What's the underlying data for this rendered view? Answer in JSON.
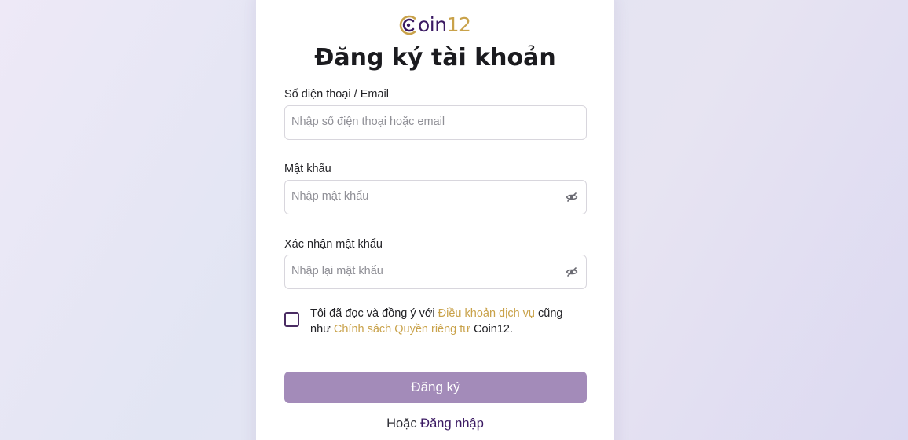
{
  "brand": {
    "logo_word": "oin",
    "logo_number": "12",
    "logo_letter": "C",
    "colors": {
      "primary": "#3b1a63",
      "gold": "#c9a24a",
      "button": "#a38bb9"
    }
  },
  "page": {
    "title": "Đăng ký tài khoản"
  },
  "form": {
    "contact": {
      "label": "Số điện thoại / Email",
      "placeholder": "Nhập số điện thoại hoặc email",
      "value": ""
    },
    "password": {
      "label": "Mật khẩu",
      "placeholder": "Nhập mật khẩu",
      "value": "",
      "toggle_icon": "eye-slash-icon"
    },
    "confirm_password": {
      "label": "Xác nhận mật khẩu",
      "placeholder": "Nhập lại mật khẩu",
      "value": "",
      "toggle_icon": "eye-slash-icon"
    },
    "consent": {
      "checked": false,
      "text_before": "Tôi đã đọc và đồng ý với ",
      "terms_link": "Điều khoản dịch vụ",
      "text_middle": " cũng như ",
      "privacy_link": "Chính sách Quyền riêng tư",
      "text_after": " Coin12."
    },
    "submit_label": "Đăng ký"
  },
  "footer": {
    "or_text": "Hoặc ",
    "login_link": "Đăng nhập"
  }
}
